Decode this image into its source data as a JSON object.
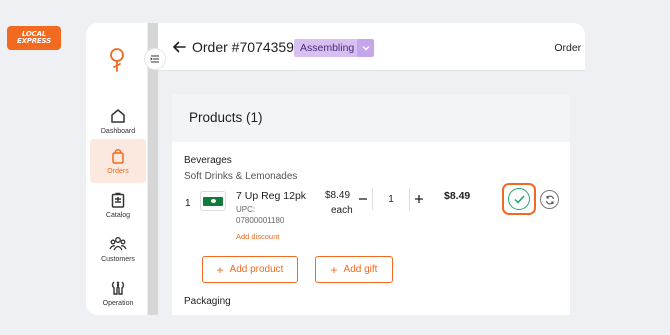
{
  "brand": {
    "line1": "LOCAL",
    "line2": "EXPRESS",
    "color": "#f26a1f"
  },
  "sidebar": {
    "items": [
      {
        "label": "Dashboard",
        "icon": "home-icon",
        "active": false
      },
      {
        "label": "Orders",
        "icon": "bag-icon",
        "active": true
      },
      {
        "label": "Catalog",
        "icon": "clipboard-icon",
        "active": false
      },
      {
        "label": "Customers",
        "icon": "users-icon",
        "active": false
      },
      {
        "label": "Operation",
        "icon": "wrench-icon",
        "active": false
      }
    ]
  },
  "header": {
    "title": "Order #7074359",
    "status": "Assembling",
    "right_text": "Order I"
  },
  "products": {
    "title": "Products (1)",
    "category": "Beverages",
    "subcategory": "Soft Drinks & Lemonades",
    "items": [
      {
        "index": "1",
        "name": "7 Up Reg 12pk",
        "upc_label": "UPC:",
        "upc": "07800001180",
        "add_discount": "Add discount",
        "unit_price": "$8.49",
        "unit_suffix": "each",
        "quantity": "1",
        "total": "$8.49"
      }
    ],
    "add_product_label": "Add product",
    "add_gift_label": "Add gift",
    "next_section": "Packaging"
  },
  "colors": {
    "accent": "#f26a1f",
    "status_bg": "#d7bff0",
    "confirm_green": "#1ea66a"
  }
}
